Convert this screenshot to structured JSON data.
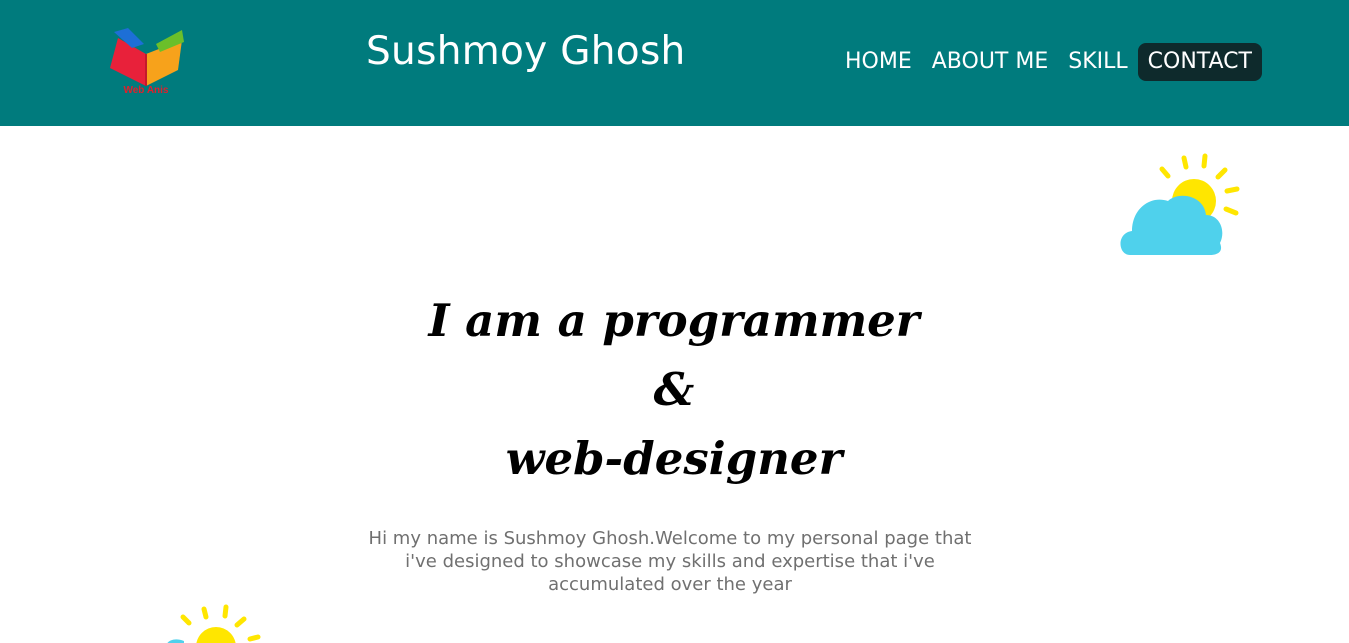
{
  "header": {
    "logo_text": "Web Anis",
    "site_title": "Sushmoy Ghosh",
    "nav": [
      {
        "label": "HOME"
      },
      {
        "label": "ABOUT ME"
      },
      {
        "label": "SKILL"
      },
      {
        "label": "CONTACT",
        "active": true
      }
    ]
  },
  "hero": {
    "headline_line1": "I am a programmer",
    "headline_line2": "&",
    "headline_line3": "web-designer",
    "intro": "Hi my name is Sushmoy Ghosh.Welcome to my personal page that i've designed to showcase my skills and expertise that i've accumulated over the year"
  },
  "colors": {
    "header_bg": "#007b7d",
    "active_nav_bg": "#0e2a2c",
    "cloud": "#4fd1ec",
    "sun": "#ffe600"
  },
  "icons": [
    "book-logo-icon",
    "cloud-sun-icon"
  ]
}
